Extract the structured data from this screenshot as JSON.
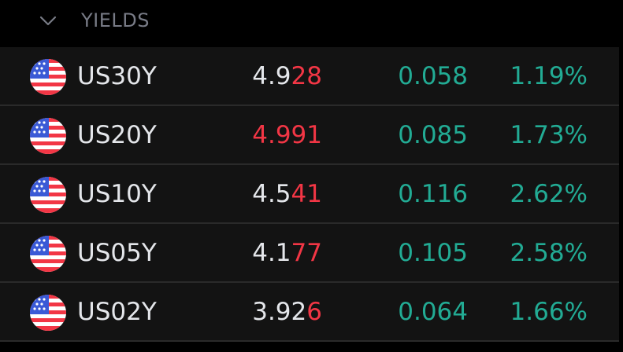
{
  "section": {
    "title": "YIELDS",
    "toggle_icon": "chevron-down-icon"
  },
  "colors": {
    "background": "#000000",
    "row_background": "#131313",
    "row_divider": "#2a2a2a",
    "header_text": "#787b86",
    "text": "#e4e6ea",
    "negative": "#f23645",
    "positive": "#22ab94"
  },
  "rows": [
    {
      "flag_icon": "us-flag-icon",
      "symbol": "US30Y",
      "last_base": "4.9",
      "last_highlight": "28",
      "change": "0.058",
      "change_pct": "1.19%"
    },
    {
      "flag_icon": "us-flag-icon",
      "symbol": "US20Y",
      "last_base": "",
      "last_highlight": "4.991",
      "change": "0.085",
      "change_pct": "1.73%"
    },
    {
      "flag_icon": "us-flag-icon",
      "symbol": "US10Y",
      "last_base": "4.5",
      "last_highlight": "41",
      "change": "0.116",
      "change_pct": "2.62%"
    },
    {
      "flag_icon": "us-flag-icon",
      "symbol": "US05Y",
      "last_base": "4.1",
      "last_highlight": "77",
      "change": "0.105",
      "change_pct": "2.58%"
    },
    {
      "flag_icon": "us-flag-icon",
      "symbol": "US02Y",
      "last_base": "3.92",
      "last_highlight": "6",
      "change": "0.064",
      "change_pct": "1.66%"
    }
  ]
}
